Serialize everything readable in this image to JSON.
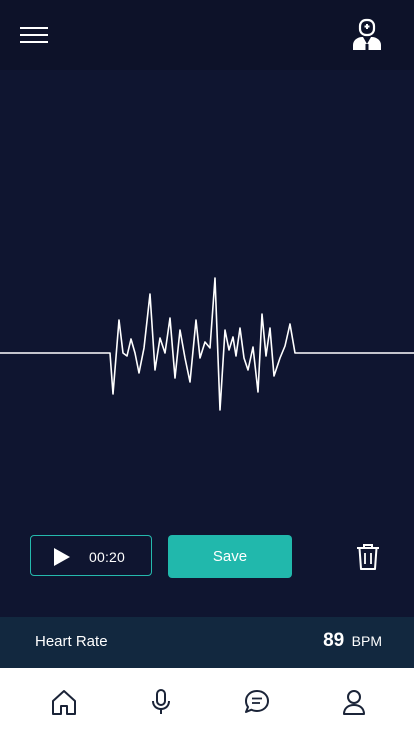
{
  "header": {
    "menu_icon": "hamburger-menu-icon",
    "doctor_icon": "doctor-icon"
  },
  "recording": {
    "waveform_icon": "heartbeat-waveform",
    "play_icon": "play-icon",
    "duration": "00:20",
    "save_label": "Save",
    "delete_icon": "trash-icon",
    "accent_color": "#21b8ac"
  },
  "heart_rate": {
    "label": "Heart Rate",
    "value": "89",
    "unit": "BPM"
  },
  "bottom_nav": {
    "items": [
      "home-icon",
      "microphone-icon",
      "chat-icon",
      "profile-icon"
    ]
  }
}
